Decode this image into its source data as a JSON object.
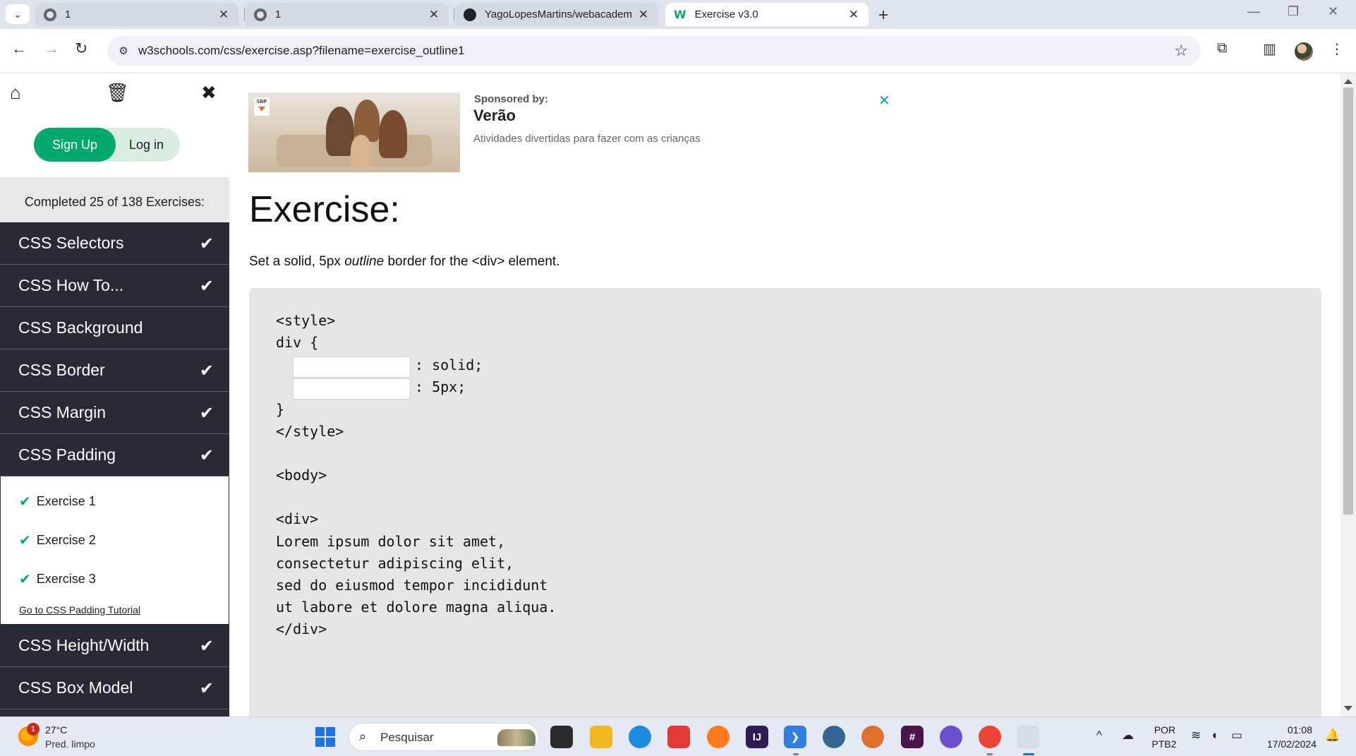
{
  "browser": {
    "tabs": [
      {
        "title": "1",
        "active": false
      },
      {
        "title": "1",
        "active": false
      },
      {
        "title": "YagoLopesMartins/webacadem",
        "active": false
      },
      {
        "title": "Exercise v3.0",
        "active": true
      }
    ],
    "url": "w3schools.com/css/exercise.asp?filename=exercise_outline1"
  },
  "sidebar": {
    "signup_label": "Sign Up",
    "login_label": "Log in",
    "completed_text": "Completed 25 of 138 Exercises:",
    "categories_before": [
      {
        "label": "CSS Selectors",
        "done": true
      },
      {
        "label": "CSS How To...",
        "done": true
      },
      {
        "label": "CSS Background",
        "done": false
      },
      {
        "label": "CSS Border",
        "done": true
      },
      {
        "label": "CSS Margin",
        "done": true
      },
      {
        "label": "CSS Padding",
        "done": true
      }
    ],
    "expanded": {
      "items": [
        "Exercise 1",
        "Exercise 2",
        "Exercise 3"
      ],
      "tutorial_link": "Go to CSS Padding Tutorial"
    },
    "categories_after": [
      {
        "label": "CSS Height/Width",
        "done": true
      },
      {
        "label": "CSS Box Model",
        "done": true
      }
    ],
    "check_glyph": "✔"
  },
  "ad": {
    "sponsor_label": "Sponsored by:",
    "sponsor_name": "Verão",
    "sponsor_desc": "Atividades divertidas para fazer com as crianças",
    "close_glyph": "✕",
    "badge_text": "SBP"
  },
  "exercise": {
    "title": "Exercise:",
    "instruction_pre": "Set a solid, 5px ",
    "instruction_em": "outline",
    "instruction_post": " border for the <div> element.",
    "code": {
      "l1": "<style>",
      "l2": "div {",
      "l3_after": ": solid;",
      "l4_after": ": 5px;",
      "l5": "}",
      "l6": "</style>",
      "l7": "<body>",
      "l8": "<div>",
      "l9": "Lorem ipsum dolor sit amet,",
      "l10": "consectetur adipiscing elit,",
      "l11": "sed do eiusmod tempor incididunt",
      "l12": "ut labore et dolore magna aliqua.",
      "l13": "</div>"
    },
    "inputs": [
      {
        "value": ""
      },
      {
        "value": ""
      }
    ]
  },
  "taskbar": {
    "weather_temp": "27°C",
    "weather_desc": "Pred. limpo",
    "weather_badge": "1",
    "search_placeholder": "Pesquisar",
    "lang_top": "POR",
    "lang_bottom": "PTB2",
    "time": "01:08",
    "date": "17/02/2024"
  },
  "colors": {
    "accent_green": "#04aa6d",
    "sidebar_dark": "#282a35",
    "code_bg": "#e6e6e6"
  }
}
